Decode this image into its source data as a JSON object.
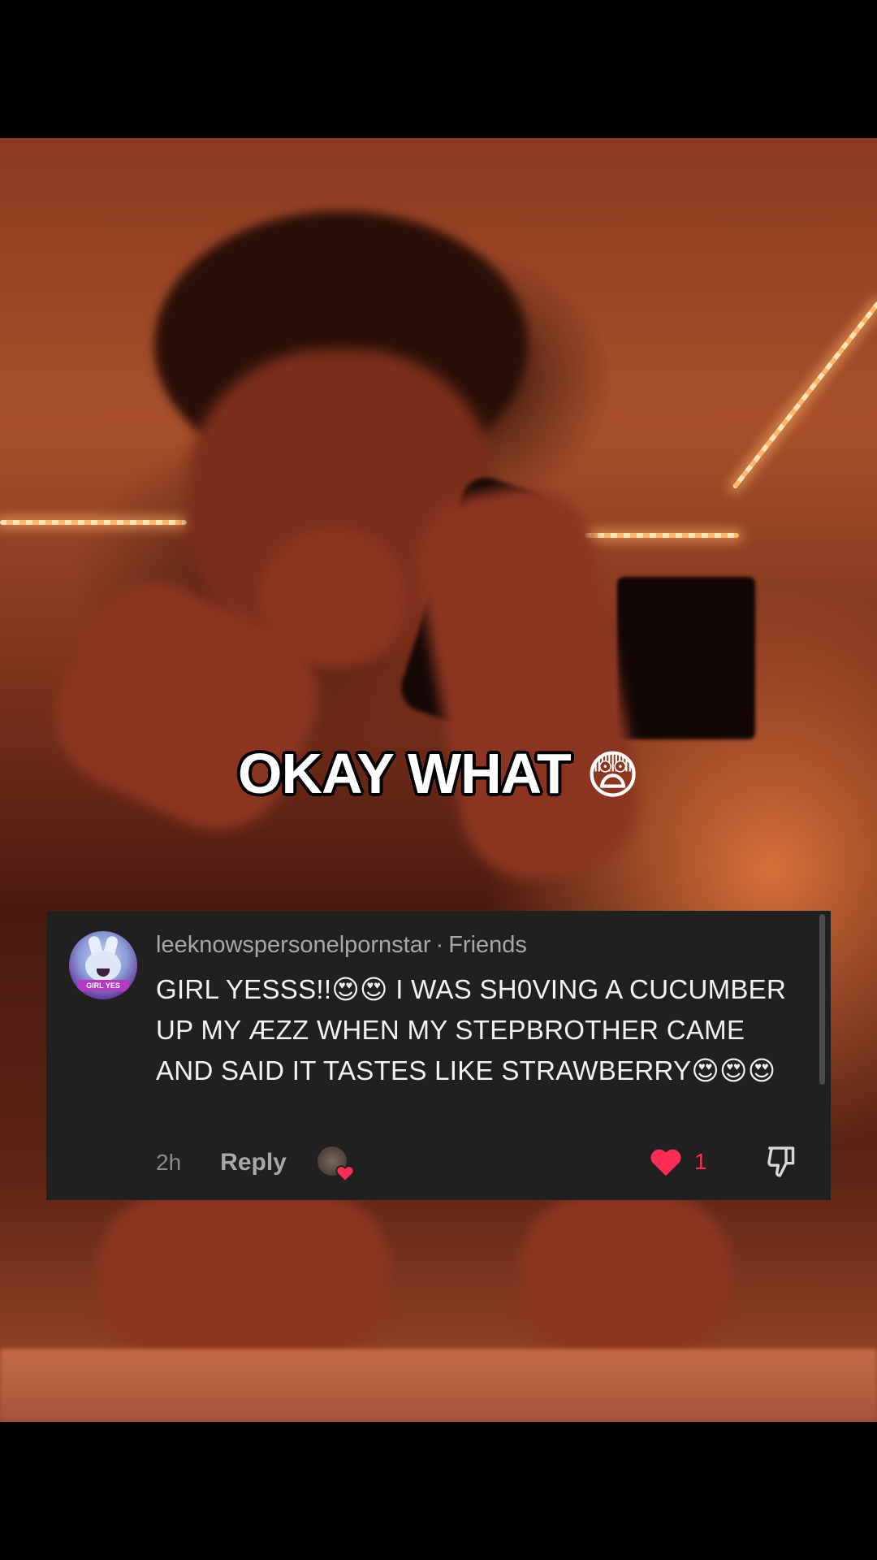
{
  "video": {
    "caption_text": "OKAY WHAT",
    "caption_emoji": "😨"
  },
  "comment": {
    "username": "leeknowspersonelpornstar",
    "separator": "·",
    "relationship": "Friends",
    "avatar_tag": "GIRL YES",
    "text": "GIRL YESSS!!😍😍 I WAS SH0VING A CUCUMBER UP MY ÆZZ WHEN MY STEPBROTHER CAME AND SAID IT TASTES LIKE STRAWBERRY😍😍😍",
    "time": "2h",
    "reply_label": "Reply",
    "like_count": "1",
    "icons": {
      "like": "heart-icon",
      "dislike": "thumbs-down-icon",
      "creator_liked": "creator-liked-heart-icon"
    },
    "colors": {
      "like_red": "#fe2c55",
      "card_bg": "#202020"
    }
  }
}
